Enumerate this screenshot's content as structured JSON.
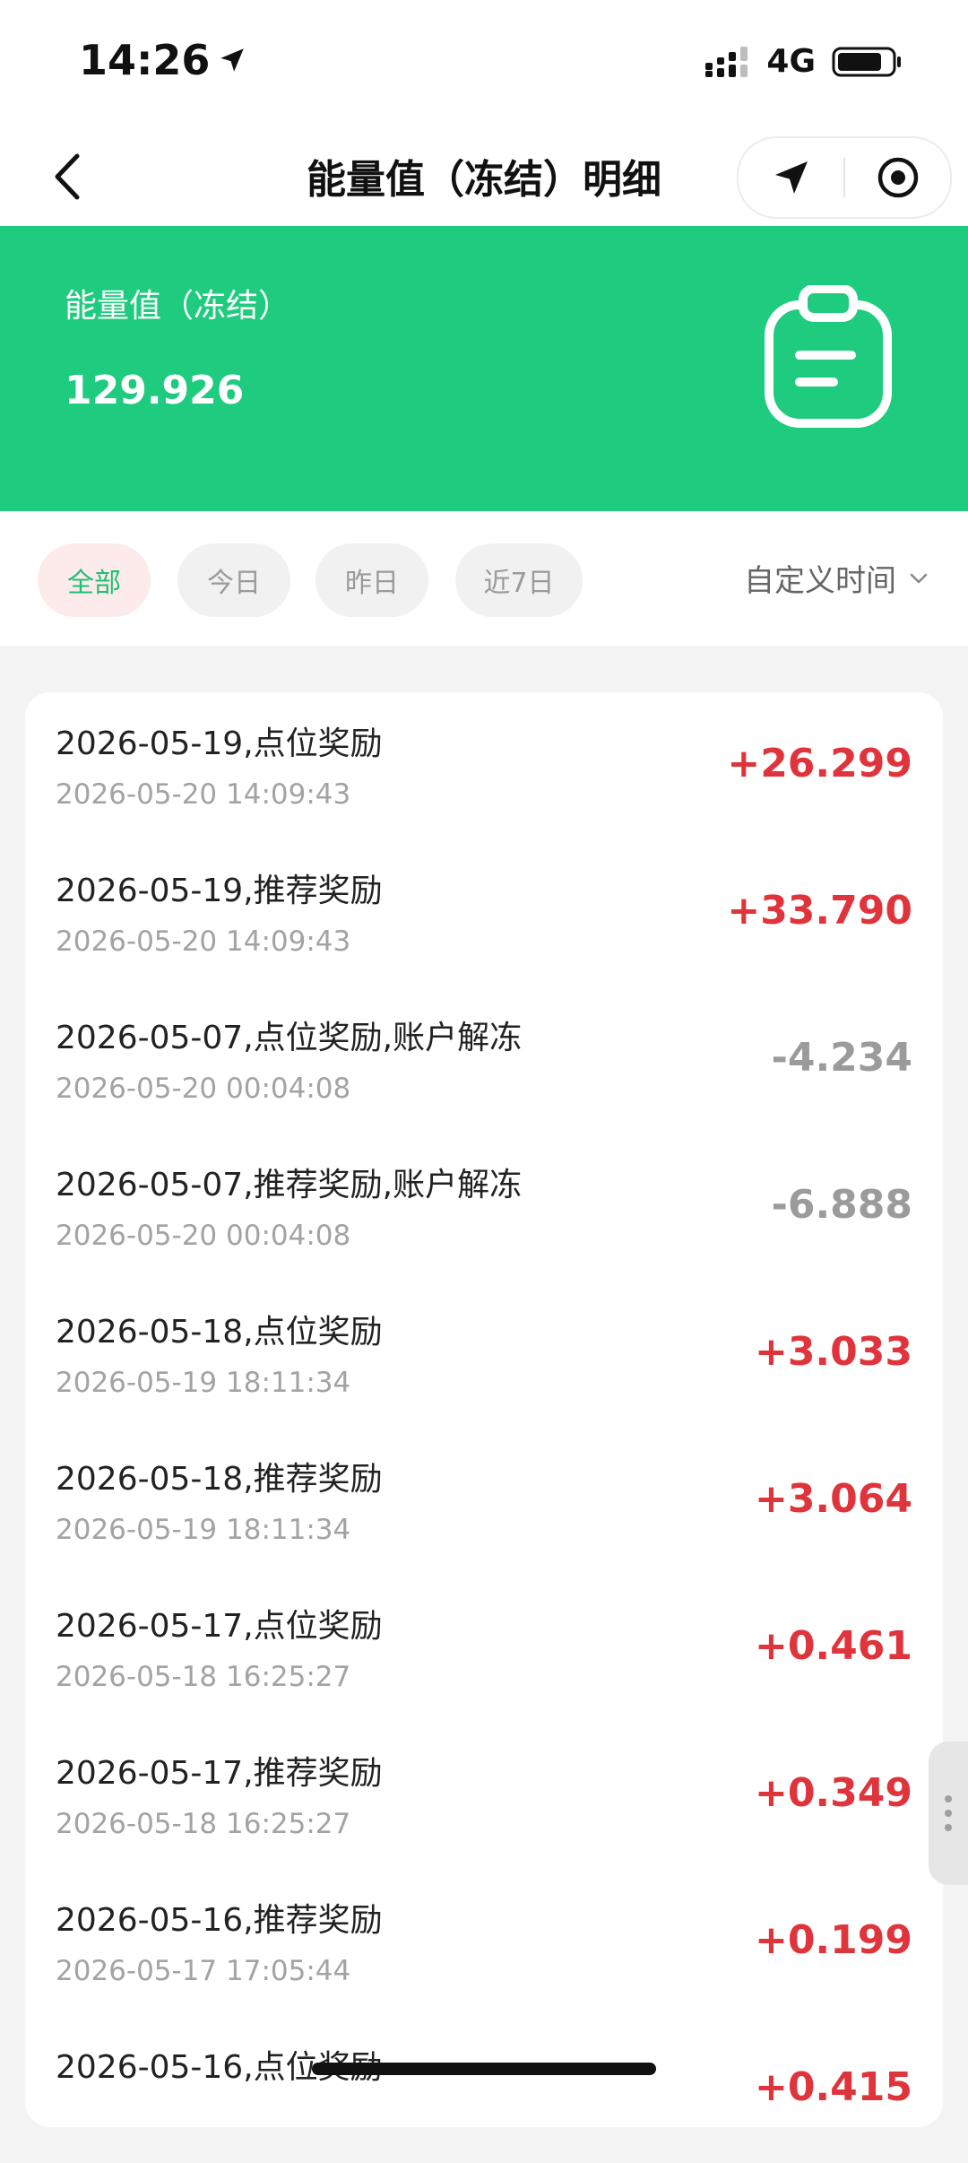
{
  "status": {
    "time": "14:26",
    "network": "4G"
  },
  "nav": {
    "title": "能量值（冻结）明细"
  },
  "banner": {
    "label": "能量值（冻结）",
    "value": "129.926",
    "color": "#1fcb7e"
  },
  "filters": {
    "chips": [
      "全部",
      "今日",
      "昨日",
      "近7日"
    ],
    "active": "全部",
    "custom_label": "自定义时间"
  },
  "records": [
    {
      "desc": "2026-05-19,点位奖励",
      "time": "2026-05-20 14:09:43",
      "amount": "+26.299",
      "sign": "pos"
    },
    {
      "desc": "2026-05-19,推荐奖励",
      "time": "2026-05-20 14:09:43",
      "amount": "+33.790",
      "sign": "pos"
    },
    {
      "desc": "2026-05-07,点位奖励,账户解冻",
      "time": "2026-05-20 00:04:08",
      "amount": "-4.234",
      "sign": "neg"
    },
    {
      "desc": "2026-05-07,推荐奖励,账户解冻",
      "time": "2026-05-20 00:04:08",
      "amount": "-6.888",
      "sign": "neg"
    },
    {
      "desc": "2026-05-18,点位奖励",
      "time": "2026-05-19 18:11:34",
      "amount": "+3.033",
      "sign": "pos"
    },
    {
      "desc": "2026-05-18,推荐奖励",
      "time": "2026-05-19 18:11:34",
      "amount": "+3.064",
      "sign": "pos"
    },
    {
      "desc": "2026-05-17,点位奖励",
      "time": "2026-05-18 16:25:27",
      "amount": "+0.461",
      "sign": "pos"
    },
    {
      "desc": "2026-05-17,推荐奖励",
      "time": "2026-05-18 16:25:27",
      "amount": "+0.349",
      "sign": "pos"
    },
    {
      "desc": "2026-05-16,推荐奖励",
      "time": "2026-05-17 17:05:44",
      "amount": "+0.199",
      "sign": "pos"
    },
    {
      "desc": "2026-05-16,点位奖励",
      "time": "",
      "amount": "+0.415",
      "sign": "pos"
    }
  ]
}
